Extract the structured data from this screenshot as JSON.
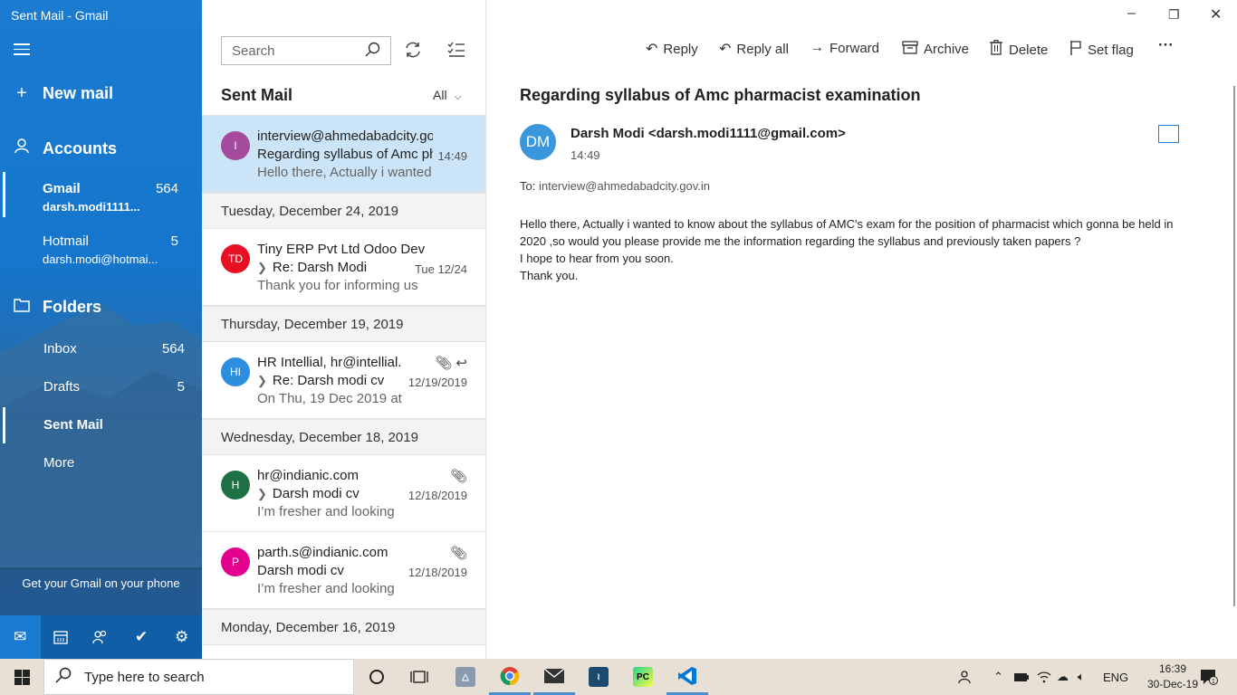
{
  "window": {
    "title": "Sent Mail - Gmail"
  },
  "sidebar": {
    "new_mail": "New mail",
    "accounts_label": "Accounts",
    "accounts": [
      {
        "name": "Gmail",
        "count": "564",
        "email": "darsh.modi1111..."
      },
      {
        "name": "Hotmail",
        "count": "5",
        "email": "darsh.modi@hotmai..."
      }
    ],
    "folders_label": "Folders",
    "folders": [
      {
        "name": "Inbox",
        "count": "564"
      },
      {
        "name": "Drafts",
        "count": "5"
      },
      {
        "name": "Sent Mail",
        "count": ""
      },
      {
        "name": "More",
        "count": ""
      }
    ],
    "promo": "Get your Gmail on your phone"
  },
  "list": {
    "search_placeholder": "Search",
    "title": "Sent Mail",
    "filter": "All",
    "date_headers": [
      "Tuesday, December 24, 2019",
      "Thursday, December 19, 2019",
      "Wednesday, December 18, 2019",
      "Monday, December 16, 2019"
    ],
    "messages": [
      {
        "initials": "I",
        "color": "#a44b9b",
        "from": "interview@ahmedabadcity.gov.in",
        "subject": "Regarding syllabus of Amc pharmacist examination",
        "preview": "Hello there, Actually i wanted to know",
        "time": "14:49"
      },
      {
        "initials": "TD",
        "color": "#e81123",
        "from": "Tiny ERP Pvt Ltd Odoo Dev",
        "subject": "Re: Darsh Modi",
        "preview": "Thank you for informing us",
        "time": "Tue 12/24"
      },
      {
        "initials": "HI",
        "color": "#2d8ee0",
        "from": "HR Intellial, hr@intellial.com",
        "subject": "Re: Darsh modi cv",
        "preview": "On Thu, 19 Dec 2019 at",
        "time": "12/19/2019"
      },
      {
        "initials": "H",
        "color": "#1e7145",
        "from": "hr@indianic.com",
        "subject": "Darsh modi cv",
        "preview": "I’m fresher and looking",
        "time": "12/18/2019"
      },
      {
        "initials": "P",
        "color": "#e3008c",
        "from": "parth.s@indianic.com",
        "subject": "Darsh modi cv",
        "preview": "I’m fresher and looking",
        "time": "12/18/2019"
      }
    ]
  },
  "toolbar": {
    "reply": "Reply",
    "reply_all": "Reply all",
    "forward": "Forward",
    "archive": "Archive",
    "delete": "Delete",
    "set_flag": "Set flag",
    "more": "···"
  },
  "reading": {
    "subject": "Regarding syllabus of Amc pharmacist examination",
    "avatar": "DM",
    "sender": "Darsh Modi <darsh.modi1111@gmail.com>",
    "time": "14:49",
    "to_label": "To:",
    "to": "interview@ahmedabadcity.gov.in",
    "body_lines": [
      "Hello there, Actually i wanted to know about the syllabus of AMC's exam for the position of pharmacist which gonna be held in 2020 ,so would you please provide me the information regarding the syllabus and previously taken papers ?",
      "I hope to hear from you soon.",
      "Thank you."
    ]
  },
  "taskbar": {
    "search": "Type here to search",
    "language": "ENG",
    "time": "16:39",
    "date": "30-Dec-19",
    "notifications": "1"
  }
}
